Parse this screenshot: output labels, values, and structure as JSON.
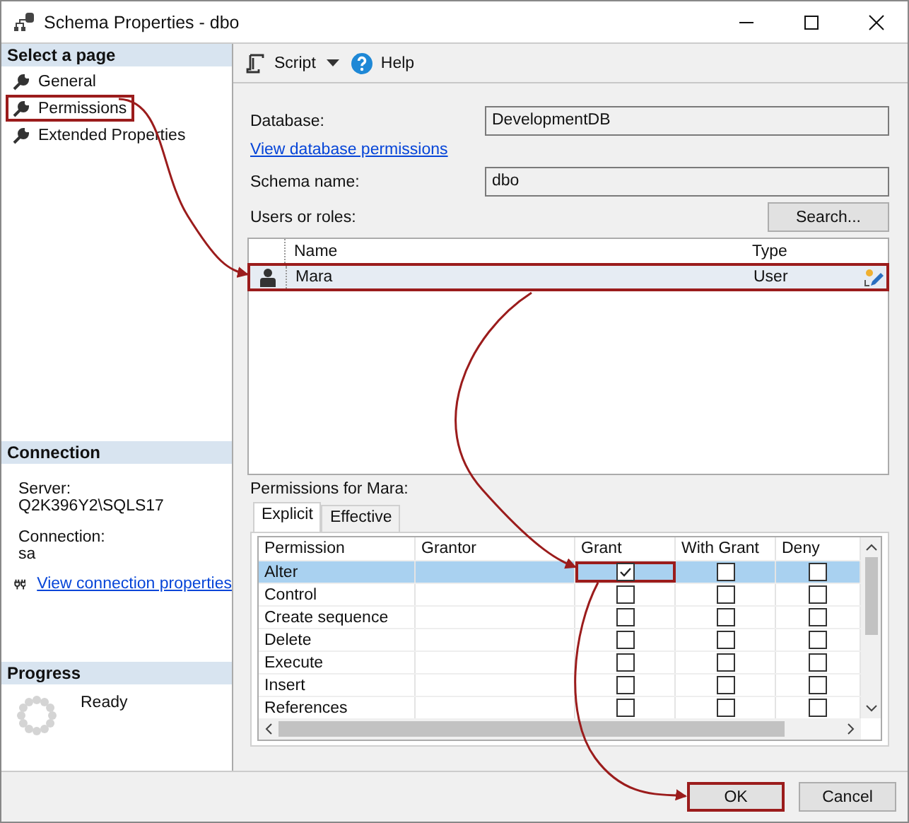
{
  "window": {
    "title": "Schema Properties - dbo"
  },
  "sidebar": {
    "header": "Select a page",
    "pages": [
      {
        "label": "General",
        "highlighted": false
      },
      {
        "label": "Permissions",
        "highlighted": true
      },
      {
        "label": "Extended Properties",
        "highlighted": false
      }
    ]
  },
  "connection": {
    "header": "Connection",
    "server_label": "Server:",
    "server": "Q2K396Y2\\SQLS17",
    "connection_label": "Connection:",
    "connection": "sa",
    "link": "View connection properties"
  },
  "progress": {
    "header": "Progress",
    "status": "Ready"
  },
  "toolbar": {
    "script": "Script",
    "help": "Help"
  },
  "form": {
    "database_label": "Database:",
    "database": "DevelopmentDB",
    "permissions_link": "View database permissions",
    "schema_label": "Schema name:",
    "schema": "dbo",
    "users_label": "Users or roles:",
    "search_button": "Search..."
  },
  "users": {
    "columns": [
      "Name",
      "Type"
    ],
    "rows": [
      {
        "name": "Mara",
        "type": "User",
        "selected": true,
        "highlighted": true
      }
    ]
  },
  "permissions": {
    "label": "Permissions for Mara:",
    "tabs": [
      {
        "label": "Explicit",
        "selected": true
      },
      {
        "label": "Effective",
        "selected": false
      }
    ],
    "columns": [
      "Permission",
      "Grantor",
      "Grant",
      "With Grant",
      "Deny"
    ],
    "rows": [
      {
        "name": "Alter",
        "grant": true,
        "with_grant": false,
        "deny": false,
        "selected": true,
        "grant_highlighted": true
      },
      {
        "name": "Control",
        "grant": false,
        "with_grant": false,
        "deny": false,
        "selected": false
      },
      {
        "name": "Create sequence",
        "grant": false,
        "with_grant": false,
        "deny": false,
        "selected": false
      },
      {
        "name": "Delete",
        "grant": false,
        "with_grant": false,
        "deny": false,
        "selected": false
      },
      {
        "name": "Execute",
        "grant": false,
        "with_grant": false,
        "deny": false,
        "selected": false
      },
      {
        "name": "Insert",
        "grant": false,
        "with_grant": false,
        "deny": false,
        "selected": false
      },
      {
        "name": "References",
        "grant": false,
        "with_grant": false,
        "deny": false,
        "selected": false
      }
    ]
  },
  "buttons": [
    {
      "label": "OK",
      "highlighted": true
    },
    {
      "label": "Cancel",
      "highlighted": false
    }
  ]
}
